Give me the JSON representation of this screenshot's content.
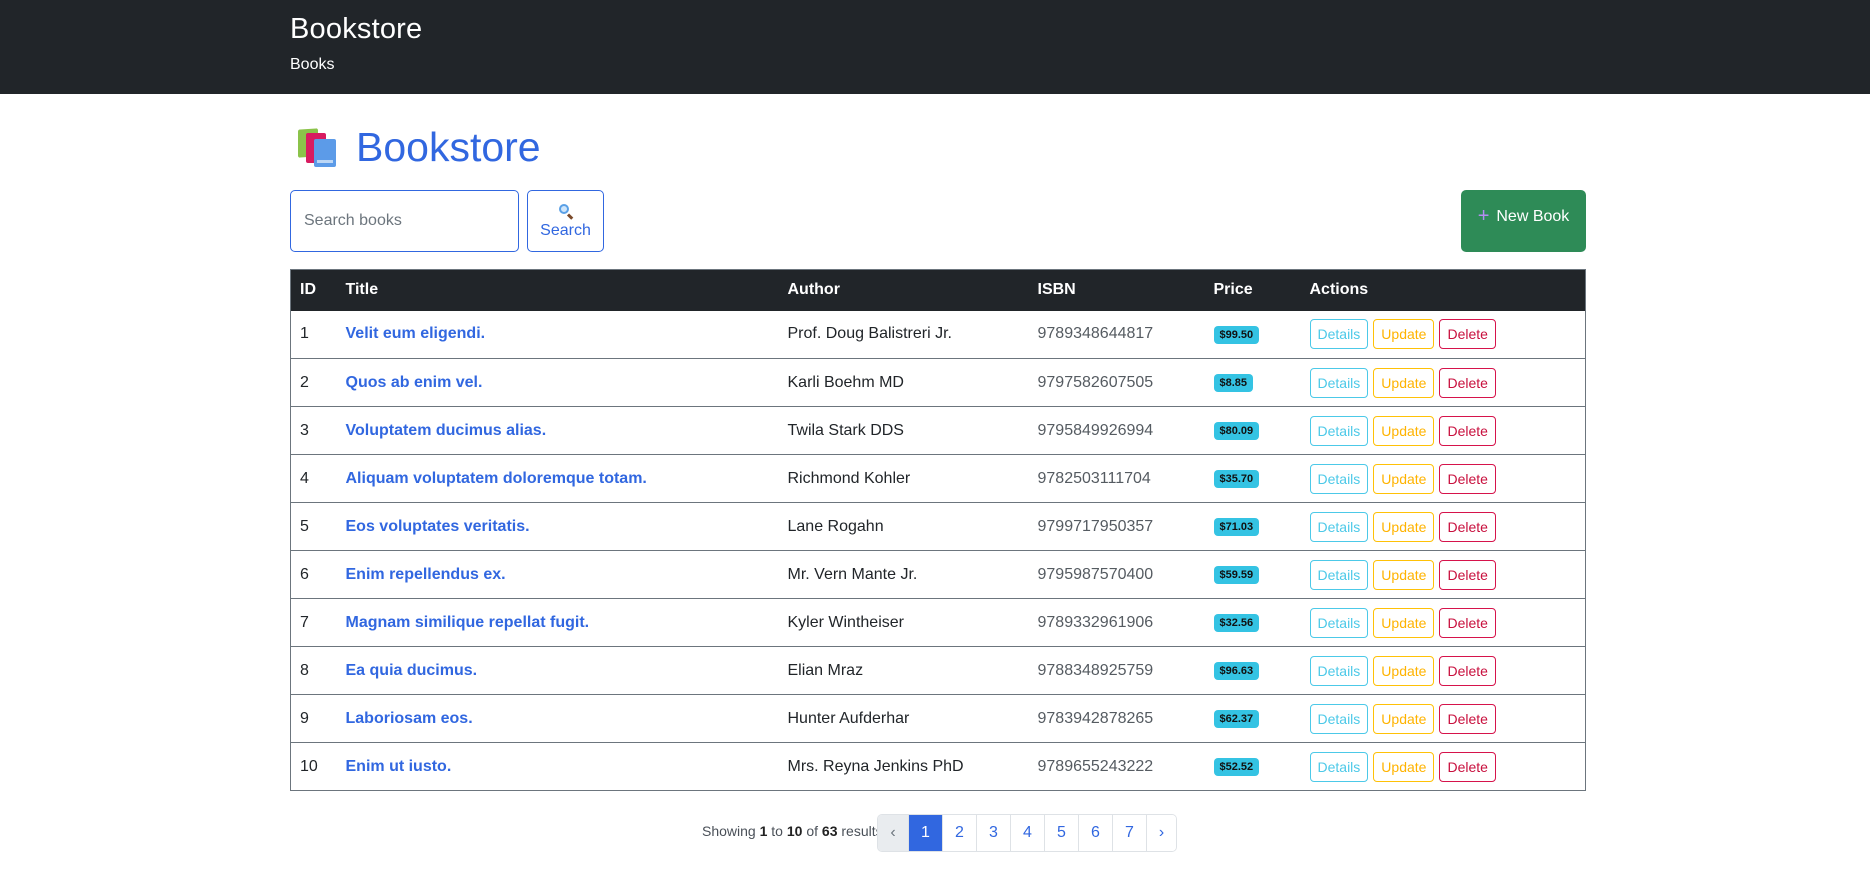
{
  "navbar": {
    "brand": "Bookstore",
    "link": "Books"
  },
  "header": {
    "title": "Bookstore",
    "icon": "books-icon"
  },
  "search": {
    "placeholder": "Search books",
    "value": "",
    "button_label": "Search",
    "button_icon": "magnifier-icon"
  },
  "toolbar": {
    "new_label": "New Book",
    "new_icon": "plus-icon"
  },
  "table": {
    "columns": [
      "ID",
      "Title",
      "Author",
      "ISBN",
      "Price",
      "Actions"
    ],
    "action_labels": {
      "details": "Details",
      "update": "Update",
      "delete": "Delete"
    },
    "rows": [
      {
        "id": "1",
        "title": "Velit eum eligendi.",
        "author": "Prof. Doug Balistreri Jr.",
        "isbn": "9789348644817",
        "price": "$99.50"
      },
      {
        "id": "2",
        "title": "Quos ab enim vel.",
        "author": "Karli Boehm MD",
        "isbn": "9797582607505",
        "price": "$8.85"
      },
      {
        "id": "3",
        "title": "Voluptatem ducimus alias.",
        "author": "Twila Stark DDS",
        "isbn": "9795849926994",
        "price": "$80.09"
      },
      {
        "id": "4",
        "title": "Aliquam voluptatem doloremque totam.",
        "author": "Richmond Kohler",
        "isbn": "9782503111704",
        "price": "$35.70"
      },
      {
        "id": "5",
        "title": "Eos voluptates veritatis.",
        "author": "Lane Rogahn",
        "isbn": "9799717950357",
        "price": "$71.03"
      },
      {
        "id": "6",
        "title": "Enim repellendus ex.",
        "author": "Mr. Vern Mante Jr.",
        "isbn": "9795987570400",
        "price": "$59.59"
      },
      {
        "id": "7",
        "title": "Magnam similique repellat fugit.",
        "author": "Kyler Wintheiser",
        "isbn": "9789332961906",
        "price": "$32.56"
      },
      {
        "id": "8",
        "title": "Ea quia ducimus.",
        "author": "Elian Mraz",
        "isbn": "9788348925759",
        "price": "$96.63"
      },
      {
        "id": "9",
        "title": "Laboriosam eos.",
        "author": "Hunter Aufderhar",
        "isbn": "9783942878265",
        "price": "$62.37"
      },
      {
        "id": "10",
        "title": "Enim ut iusto.",
        "author": "Mrs. Reyna Jenkins PhD",
        "isbn": "9789655243222",
        "price": "$52.52"
      }
    ]
  },
  "pagination": {
    "showing_prefix": "Showing",
    "from": "1",
    "to_word": "to",
    "to": "10",
    "of_word": "of",
    "total": "63",
    "suffix": "results",
    "prev": "‹",
    "next": "›",
    "pages": [
      "1",
      "2",
      "3",
      "4",
      "5",
      "6",
      "7"
    ],
    "current": "1"
  },
  "colors": {
    "navbar": "#212529",
    "accent": "#3167e0",
    "success": "#2e8b57",
    "info": "#34c3e3",
    "warning": "#ffc107",
    "danger": "#d6134b"
  }
}
